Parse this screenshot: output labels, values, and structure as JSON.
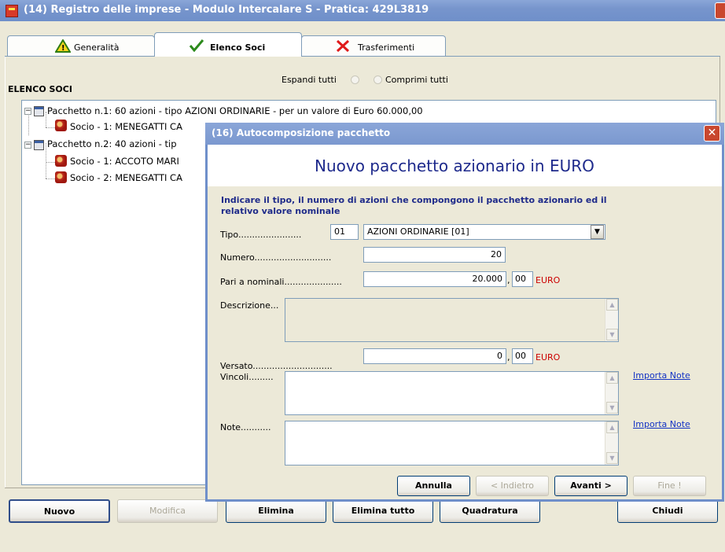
{
  "window": {
    "title": "(14) Registro delle imprese - Modulo Intercalare S - Pratica: 429L3819"
  },
  "tabs": [
    {
      "label": "Generalità",
      "icon": "warning-icon"
    },
    {
      "label": "Elenco Soci",
      "icon": "checkmark-icon"
    },
    {
      "label": "Trasferimenti",
      "icon": "x-icon"
    }
  ],
  "section_title": "ELENCO SOCI",
  "expand": {
    "expand_label": "Espandi tutti",
    "collapse_label": "Comprimi tutti"
  },
  "tree": {
    "items": [
      {
        "label": "Pacchetto n.1: 60 azioni - tipo AZIONI ORDINARIE - per un valore di Euro 60.000,00"
      },
      {
        "label": "Socio - 1: MENEGATTI CA"
      },
      {
        "label": "Pacchetto n.2: 40 azioni - tip"
      },
      {
        "label": "Socio - 1: ACCOTO MARI"
      },
      {
        "label": "Socio - 2: MENEGATTI CA"
      }
    ]
  },
  "buttons": {
    "nuovo": "Nuovo",
    "modifica": "Modifica",
    "elimina": "Elimina",
    "elimina_tutto": "Elimina tutto",
    "quadratura": "Quadratura",
    "chiudi": "Chiudi"
  },
  "dialog": {
    "title": "(16) Autocomposizione pacchetto",
    "heading": "Nuovo pacchetto azionario in EURO",
    "instructions": "Indicare il tipo, il numero di azioni che compongono il pacchetto azionario ed il relativo valore nominale",
    "tipo_label": "Tipo.......................",
    "tipo_code": "01",
    "tipo_value": "AZIONI ORDINARIE [01]",
    "numero_label": "Numero............................",
    "numero_value": "20",
    "pari_label": "Pari a nominali.....................",
    "pari_int": "20.000",
    "pari_dec": "00",
    "currency": "EURO",
    "descrizione_label": "Descrizione...",
    "versato_label": "Versato.............................",
    "versato_int": "0",
    "versato_dec": "00",
    "vincoli_label": "Vincoli.........",
    "note_label": "Note...........",
    "importa_note": "Importa Note",
    "btn_annulla": "Annulla",
    "btn_indietro": "< Indietro",
    "btn_avanti": "Avanti >",
    "btn_fine": "Fine !"
  }
}
